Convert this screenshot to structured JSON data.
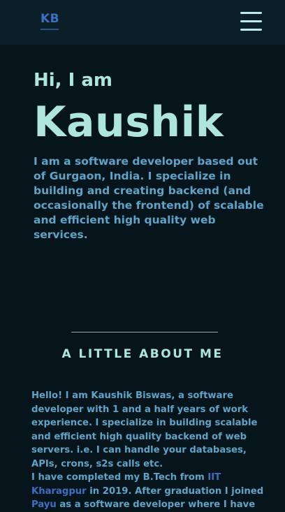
{
  "nav": {
    "logo": "KB",
    "menu_icon": "hamburger-menu-icon"
  },
  "hero": {
    "greeting": "Hi, I am",
    "name": "Kaushik",
    "description": "I am a software developer based out of Gurgaon, India. I specialize in building and creating backend (and occasionally the frontend) of scalable and efficient high quality web services."
  },
  "about": {
    "title": "A LITTLE ABOUT ME",
    "paragraph1": "Hello! I am Kaushik Biswas, a software developer with 1 and a half years of work experience. I specialize in building scalable and efficient high quality backend of web servers. i.e. I can handle your databases, APIs, crons, s2s calls etc.",
    "p2_part1": "I have completed my B.Tech from ",
    "p2_link1": "IIT Kharagpur",
    "p2_part2": " in 2019. After graduation I joined ",
    "p2_link2": "Payu",
    "p2_part3": " as a software developer where I have"
  },
  "colors": {
    "background": "#06151c",
    "nav_background": "#0a1f27",
    "heading": "#aee6df",
    "body_text": "#5fa3c7",
    "link": "#3f6fc4"
  }
}
